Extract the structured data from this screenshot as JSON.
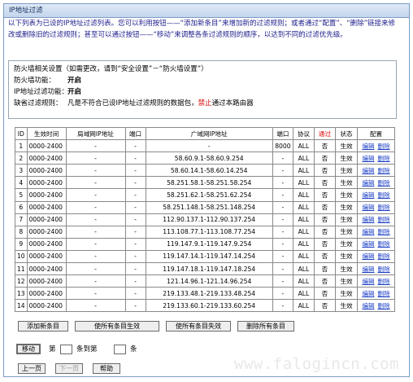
{
  "panel": {
    "title": "IP地址过滤"
  },
  "intro": {
    "text": "以下列表为已设的IP地址过滤列表。您可以利用按钮——“添加新条目”来增加新的过滤规则；或者通过“配置”、“删除”链接来修改或删除旧的过滤规则；甚至可以通过按钮——“移动”来调整各条过滤规则的顺序，以达到不同的过滤优先级。"
  },
  "firewall": {
    "heading": "防火墙相关设置（如需更改，请到“安全设置”－“防火墙设置”）",
    "items": [
      {
        "label": "防火墙功能：",
        "value": "开启"
      },
      {
        "label": "IP地址过滤功能：",
        "value": "开启"
      }
    ],
    "default_rule_label": "缺省过滤规则：",
    "default_rule_pre": "凡是不符合已设IP地址过滤规则的数据包，",
    "default_rule_red": "禁止",
    "default_rule_post": "通过本路由器"
  },
  "table": {
    "headers": [
      "ID",
      "生效时间",
      "局域网IP地址",
      "端口",
      "广域网IP地址",
      "端口",
      "协议",
      "通过",
      "状态",
      "配置"
    ],
    "pass_header_color": "#e10000",
    "edit_label": "编辑",
    "delete_label": "删除",
    "rows": [
      {
        "id": "1",
        "time": "0000-2400",
        "lan_ip": "-",
        "lan_port": "-",
        "wan_ip": "-",
        "wan_port": "8000",
        "proto": "ALL",
        "pass": "否",
        "status": "生效"
      },
      {
        "id": "2",
        "time": "0000-2400",
        "lan_ip": "-",
        "lan_port": "-",
        "wan_ip": "58.60.9.1-58.60.9.254",
        "wan_port": "-",
        "proto": "ALL",
        "pass": "否",
        "status": "生效"
      },
      {
        "id": "3",
        "time": "0000-2400",
        "lan_ip": "-",
        "lan_port": "-",
        "wan_ip": "58.60.14.1-58.60.14.254",
        "wan_port": "-",
        "proto": "ALL",
        "pass": "否",
        "status": "生效"
      },
      {
        "id": "4",
        "time": "0000-2400",
        "lan_ip": "-",
        "lan_port": "-",
        "wan_ip": "58.251.58.1-58.251.58.254",
        "wan_port": "-",
        "proto": "ALL",
        "pass": "否",
        "status": "生效"
      },
      {
        "id": "5",
        "time": "0000-2400",
        "lan_ip": "-",
        "lan_port": "-",
        "wan_ip": "58.251.62.1-58.251.62.254",
        "wan_port": "-",
        "proto": "ALL",
        "pass": "否",
        "status": "生效"
      },
      {
        "id": "6",
        "time": "0000-2400",
        "lan_ip": "-",
        "lan_port": "-",
        "wan_ip": "58.251.148.1-58.251.148.254",
        "wan_port": "-",
        "proto": "ALL",
        "pass": "否",
        "status": "生效"
      },
      {
        "id": "7",
        "time": "0000-2400",
        "lan_ip": "-",
        "lan_port": "-",
        "wan_ip": "112.90.137.1-112.90.137.254",
        "wan_port": "-",
        "proto": "ALL",
        "pass": "否",
        "status": "生效"
      },
      {
        "id": "8",
        "time": "0000-2400",
        "lan_ip": "-",
        "lan_port": "-",
        "wan_ip": "113.108.77.1-113.108.77.254",
        "wan_port": "-",
        "proto": "ALL",
        "pass": "否",
        "status": "生效"
      },
      {
        "id": "9",
        "time": "0000-2400",
        "lan_ip": "-",
        "lan_port": "-",
        "wan_ip": "119.147.9.1-119.147.9.254",
        "wan_port": "-",
        "proto": "ALL",
        "pass": "否",
        "status": "生效"
      },
      {
        "id": "10",
        "time": "0000-2400",
        "lan_ip": "-",
        "lan_port": "-",
        "wan_ip": "119.147.14.1-119.147.14.254",
        "wan_port": "-",
        "proto": "ALL",
        "pass": "否",
        "status": "生效"
      },
      {
        "id": "11",
        "time": "0000-2400",
        "lan_ip": "-",
        "lan_port": "-",
        "wan_ip": "119.147.18.1-119.147.18.254",
        "wan_port": "-",
        "proto": "ALL",
        "pass": "否",
        "status": "生效"
      },
      {
        "id": "12",
        "time": "0000-2400",
        "lan_ip": "-",
        "lan_port": "-",
        "wan_ip": "121.14.96.1-121.14.96.254",
        "wan_port": "-",
        "proto": "ALL",
        "pass": "否",
        "status": "生效"
      },
      {
        "id": "13",
        "time": "0000-2400",
        "lan_ip": "-",
        "lan_port": "-",
        "wan_ip": "219.133.48.1-219.133.48.254",
        "wan_port": "-",
        "proto": "ALL",
        "pass": "否",
        "status": "生效"
      },
      {
        "id": "14",
        "time": "0000-2400",
        "lan_ip": "-",
        "lan_port": "-",
        "wan_ip": "219.133.60.1-219.133.60.254",
        "wan_port": "-",
        "proto": "ALL",
        "pass": "否",
        "status": "生效"
      }
    ]
  },
  "actions": {
    "add": "添加新条目",
    "enable_all": "使所有条目生效",
    "disable_all": "使所有条目失效",
    "delete_all": "删除所有条目"
  },
  "move": {
    "button": "移动",
    "label_item": "第",
    "label_to": "条到第",
    "label_end": "条",
    "from_value": "",
    "to_value": ""
  },
  "paging": {
    "prev": "上一页",
    "next": "下一页",
    "help": "帮助"
  },
  "watermark": "www.falogincn.com"
}
